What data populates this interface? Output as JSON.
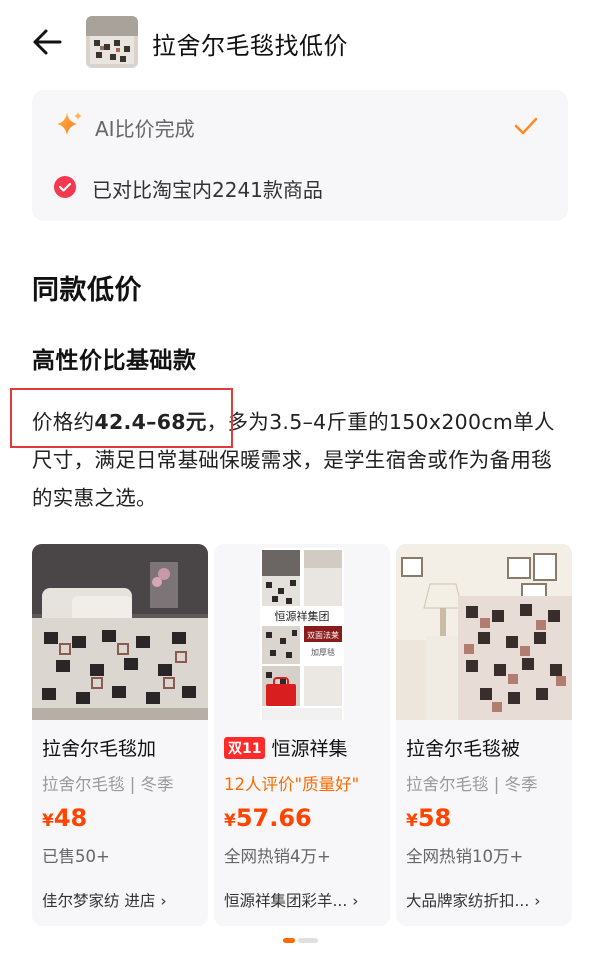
{
  "header": {
    "title": "拉舍尔毛毯找低价"
  },
  "ai_box": {
    "status": "AI比价完成",
    "compare_text": "已对比淘宝内2241款商品"
  },
  "section": {
    "title": "同款低价",
    "subtitle": "高性价比基础款",
    "desc_prefix": "价格约",
    "price_range": "42.4–68元",
    "desc_rest": "，多为3.5–4斤重的150x200cm单人尺寸，满足日常基础保暖需求，是学生宿舍或作为备用毯的实惠之选。"
  },
  "cards": [
    {
      "title": "拉舍尔毛毯加",
      "subtitle": "拉舍尔毛毯 | 冬季",
      "currency": "¥",
      "price": "48",
      "sold": "已售50+",
      "shop": "佳尔梦家纺 进店 ›"
    },
    {
      "badge": "双11",
      "title": "恒源祥集",
      "subtitle": "12人评价\"质量好\"",
      "currency": "¥",
      "price": "57.66",
      "sold": "全网热销4万+",
      "shop": "恒源祥集团彩羊... ›",
      "img_texts": [
        "恒源祥集团",
        "双面法莱",
        "加厚毯"
      ]
    },
    {
      "title": "拉舍尔毛毯被",
      "subtitle": "拉舍尔毛毯 | 冬季",
      "currency": "¥",
      "price": "58",
      "sold": "全网热销10万+",
      "shop": "大品牌家纺折扣... ›"
    }
  ],
  "colors": {
    "accent": "#ff6a00",
    "price": "#ff4400",
    "highlight_border": "#e03a3a",
    "check_badge": "#f3384f"
  }
}
